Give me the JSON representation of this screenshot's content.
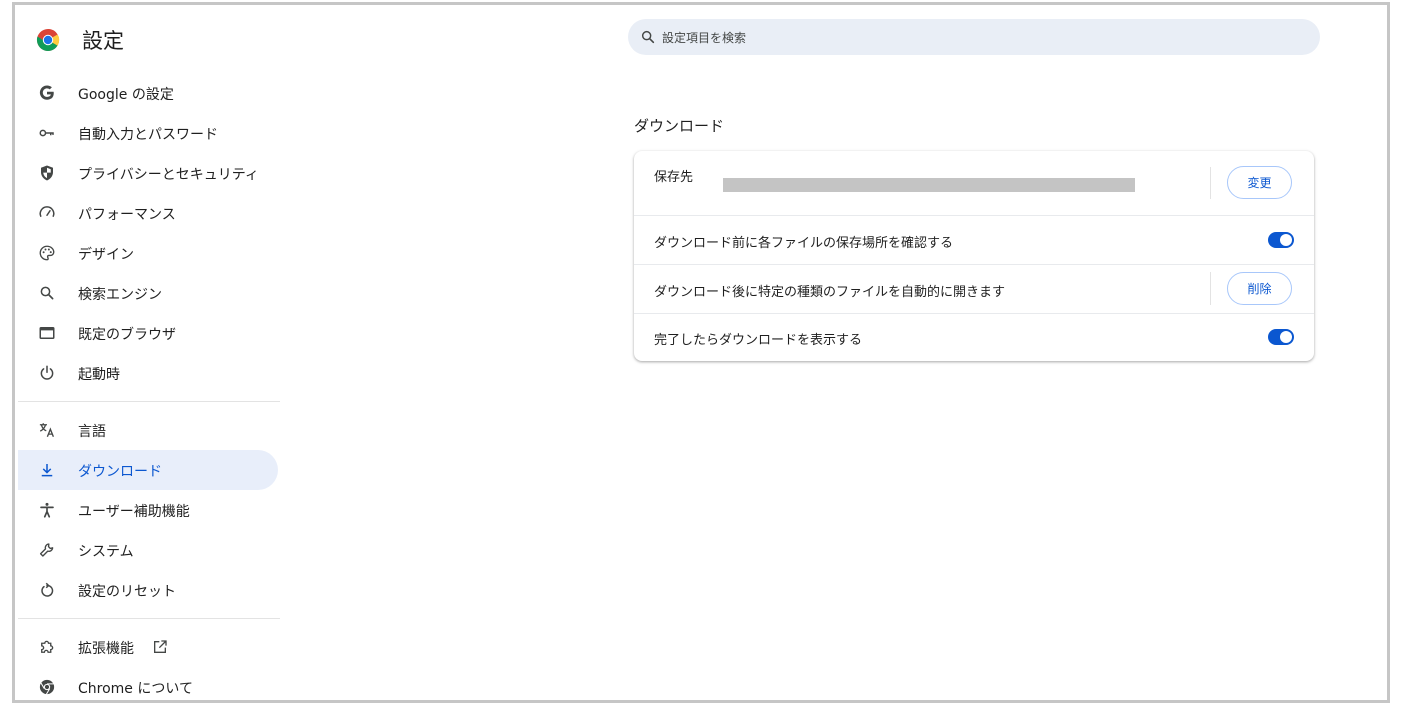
{
  "header": {
    "app_title": "設定",
    "search_placeholder": "設定項目を検索"
  },
  "sidebar": {
    "items": [
      {
        "label": "Google の設定",
        "icon": "google-g-icon"
      },
      {
        "label": "自動入力とパスワード",
        "icon": "key-icon"
      },
      {
        "label": "プライバシーとセキュリティ",
        "icon": "shield-icon"
      },
      {
        "label": "パフォーマンス",
        "icon": "speedometer-icon"
      },
      {
        "label": "デザイン",
        "icon": "palette-icon"
      },
      {
        "label": "検索エンジン",
        "icon": "search-icon"
      },
      {
        "label": "既定のブラウザ",
        "icon": "browser-window-icon"
      },
      {
        "label": "起動時",
        "icon": "power-icon"
      },
      {
        "label": "言語",
        "icon": "translate-icon"
      },
      {
        "label": "ダウンロード",
        "icon": "download-icon",
        "active": true
      },
      {
        "label": "ユーザー補助機能",
        "icon": "accessibility-icon"
      },
      {
        "label": "システム",
        "icon": "wrench-icon"
      },
      {
        "label": "設定のリセット",
        "icon": "reset-icon"
      },
      {
        "label": "拡張機能",
        "icon": "puzzle-icon"
      },
      {
        "label": "Chrome について",
        "icon": "chrome-icon"
      }
    ]
  },
  "main": {
    "section_title": "ダウンロード",
    "save_location_label": "保存先",
    "change_button": "変更",
    "ask_before_download_label": "ダウンロード前に各ファイルの保存場所を確認する",
    "ask_before_download_on": true,
    "auto_open_label": "ダウンロード後に特定の種類のファイルを自動的に開きます",
    "clear_button": "削除",
    "show_when_done_label": "完了したらダウンロードを表示する",
    "show_when_done_on": true
  },
  "colors": {
    "accent": "#0b57d0",
    "active_bg": "#e8eefa",
    "search_bg": "#e9eef6"
  }
}
